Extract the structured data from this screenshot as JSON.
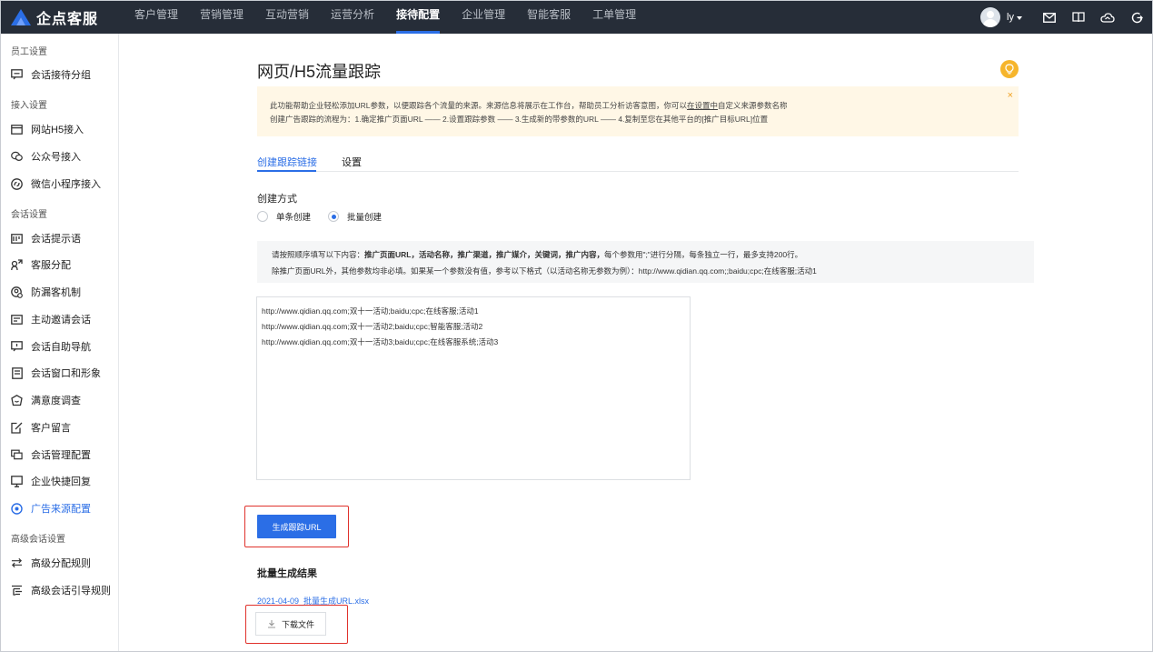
{
  "app": {
    "name": "企点客服"
  },
  "nav": {
    "items": [
      {
        "label": "客户管理"
      },
      {
        "label": "营销管理"
      },
      {
        "label": "互动营销"
      },
      {
        "label": "运营分析"
      },
      {
        "label": "接待配置",
        "active": true
      },
      {
        "label": "企业管理"
      },
      {
        "label": "智能客服"
      },
      {
        "label": "工单管理"
      }
    ],
    "user": "ly"
  },
  "icons": {
    "top": [
      "mail-icon",
      "book-icon",
      "cloud-icon",
      "logout-icon"
    ],
    "accent": "#2b6ee6",
    "topbar_bg": "#262d38"
  },
  "sidebar": {
    "groups": [
      {
        "title": "员工设置",
        "items": [
          {
            "label": "会话接待分组",
            "icon": "chat-group-icon"
          }
        ]
      },
      {
        "title": "接入设置",
        "items": [
          {
            "label": "网站H5接入",
            "icon": "web-icon"
          },
          {
            "label": "公众号接入",
            "icon": "wechat-icon"
          },
          {
            "label": "微信小程序接入",
            "icon": "miniprogram-icon"
          }
        ]
      },
      {
        "title": "会话设置",
        "items": [
          {
            "label": "会话提示语",
            "icon": "hint-icon"
          },
          {
            "label": "客服分配",
            "icon": "assign-icon"
          },
          {
            "label": "防漏客机制",
            "icon": "guard-icon"
          },
          {
            "label": "主动邀请会话",
            "icon": "invite-icon"
          },
          {
            "label": "会话自助导航",
            "icon": "navigation-icon"
          },
          {
            "label": "会话窗口和形象",
            "icon": "window-icon"
          },
          {
            "label": "满意度调查",
            "icon": "survey-icon"
          },
          {
            "label": "客户留言",
            "icon": "message-icon"
          },
          {
            "label": "会话管理配置",
            "icon": "manage-icon"
          },
          {
            "label": "企业快捷回复",
            "icon": "quick-reply-icon"
          },
          {
            "label": "广告来源配置",
            "icon": "target-icon",
            "active": true
          }
        ]
      },
      {
        "title": "高级会话设置",
        "items": [
          {
            "label": "高级分配规则",
            "icon": "rule-icon"
          },
          {
            "label": "高级会话引导规则",
            "icon": "guide-rule-icon"
          }
        ]
      }
    ]
  },
  "main": {
    "title": "网页/H5流量跟踪",
    "notice": {
      "line1_a": "此功能帮助企业轻松添加URL参数，以便跟踪各个流量的来源。来源信息将展示在工作台，帮助员工分析访客意图，你可以",
      "line1_link": "在设置中",
      "line1_b": "自定义来源参数名称",
      "line2": "创建广告跟踪的流程为：1.确定推广页面URL —— 2.设置跟踪参数 —— 3.生成新的带参数的URL —— 4.复制至您在其他平台的[推广目标URL]位置",
      "close": "×"
    },
    "tabs": [
      {
        "label": "创建跟踪链接",
        "active": true
      },
      {
        "label": "设置"
      }
    ],
    "create_mode_label": "创建方式",
    "modes": [
      {
        "label": "单条创建",
        "checked": false
      },
      {
        "label": "批量创建",
        "checked": true
      }
    ],
    "guide": {
      "line1_a": "请按照顺序填写以下内容：",
      "line1_bold": "推广页面URL，活动名称，推广渠道，推广媒介，关键词，推广内容，",
      "line1_b": "每个参数用\";\"进行分隔，每条独立一行，最多支持200行。",
      "line2": "除推广页面URL外，其他参数均非必填。如果某一个参数没有值，参考以下格式（以活动名称无参数为例）：http://www.qidian.qq.com;;baidu;cpc;在线客服;活动1"
    },
    "textarea_lines": [
      "http://www.qidian.qq.com;双十一活动;baidu;cpc;在线客服;活动1",
      "http://www.qidian.qq.com;双十一活动2;baidu;cpc;智能客服;活动2",
      "http://www.qidian.qq.com;双十一活动3;baidu;cpc;在线客服系统;活动3"
    ],
    "generate_button": "生成跟踪URL",
    "result_title": "批量生成结果",
    "result_file": "2021-04-09_批量生成URL.xlsx",
    "download_button": "下载文件"
  }
}
